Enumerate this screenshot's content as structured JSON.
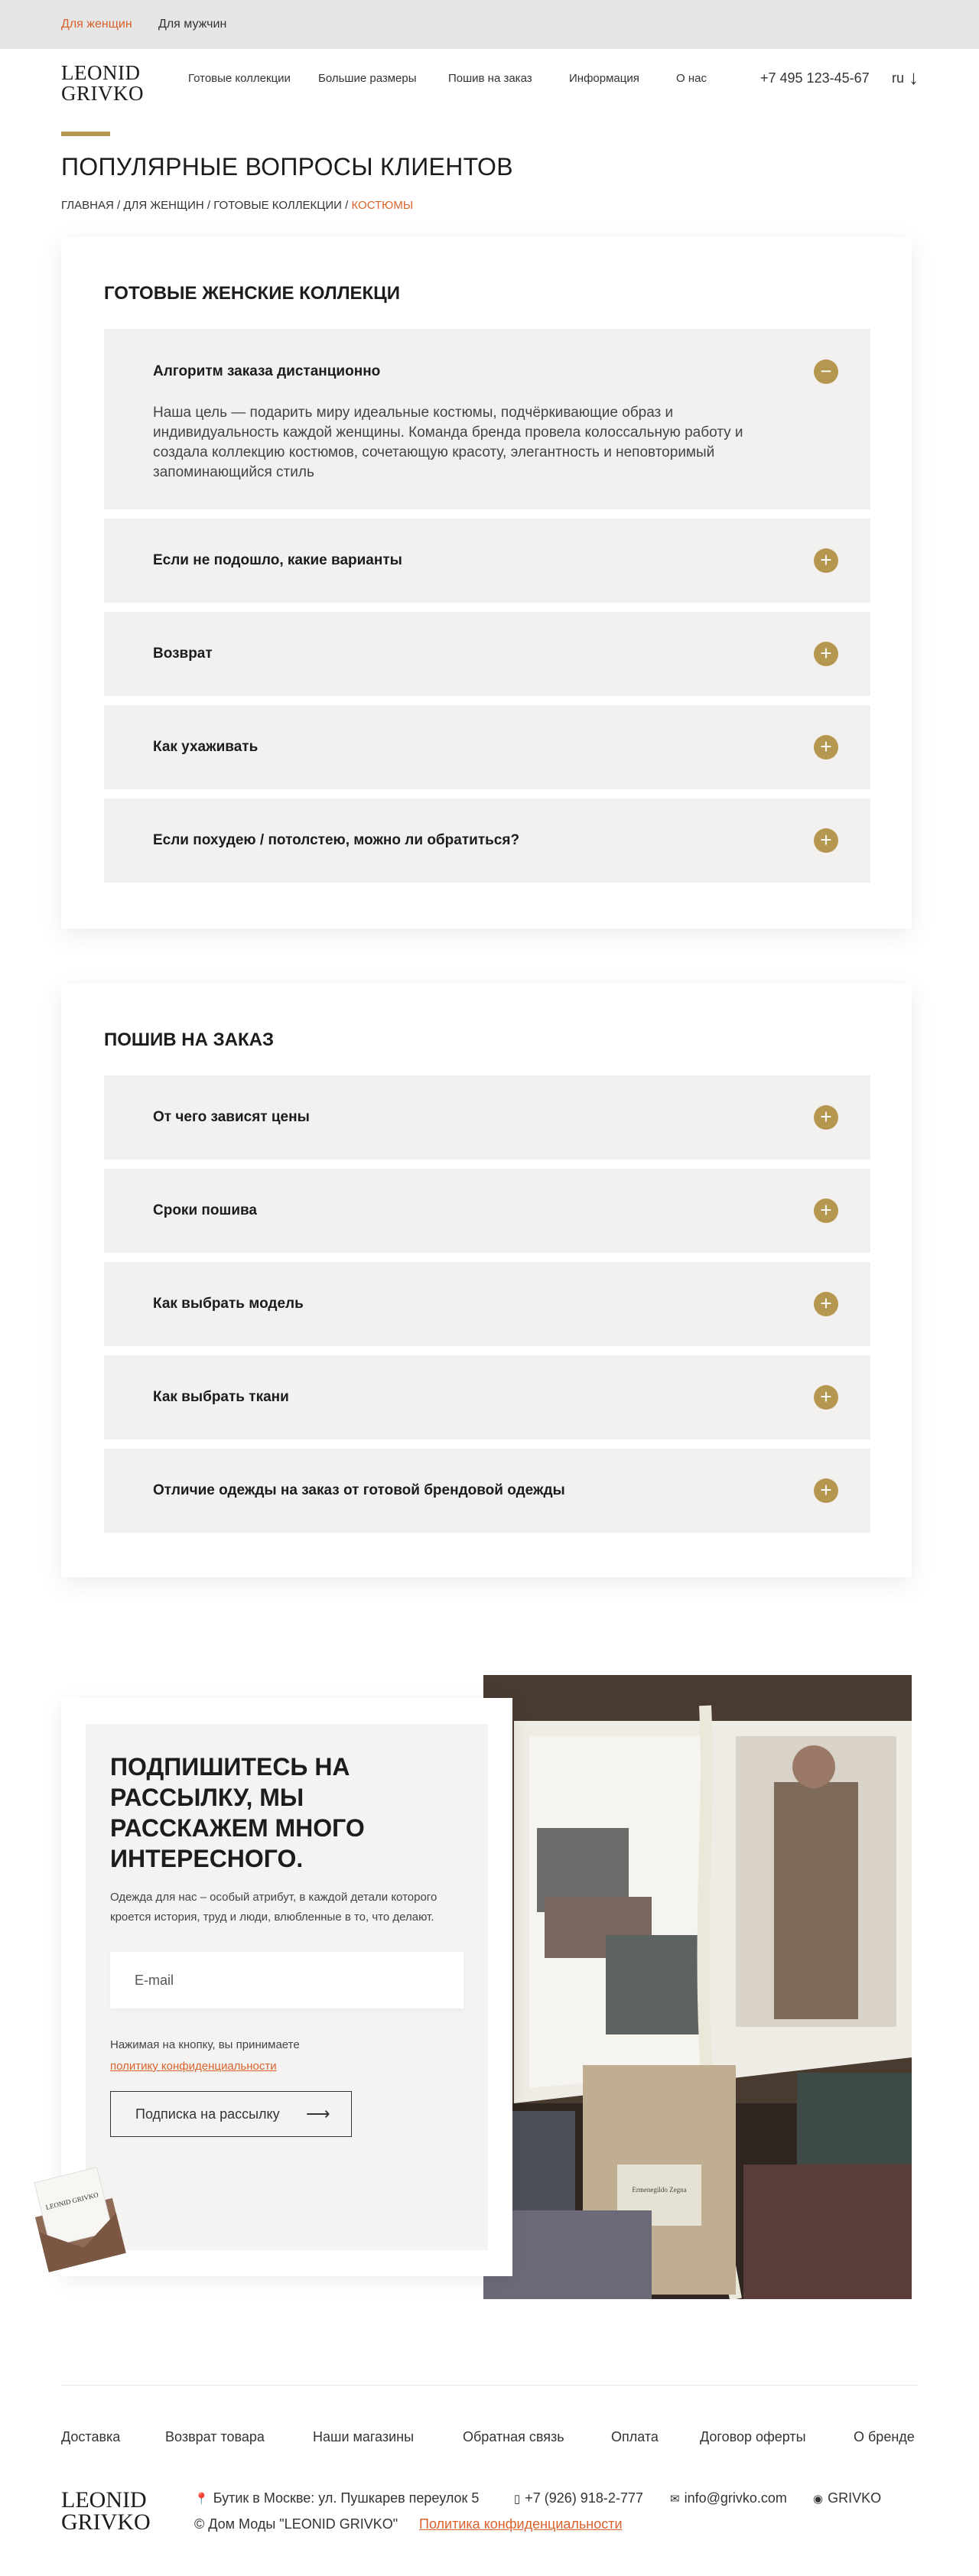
{
  "topbar": {
    "women": "Для женщин",
    "men": "Для мужчин"
  },
  "header": {
    "logo_line1": "LEONID",
    "logo_line2": "GRIVKO",
    "nav": [
      "Готовые коллекции",
      "Большие размеры",
      "Пошив на заказ",
      "Информация",
      "О нас"
    ],
    "phone": "+7 495 123-45-67",
    "lang": "ru",
    "lang_arrow": "↓"
  },
  "page": {
    "title": "ПОПУЛЯРНЫЕ ВОПРОСЫ КЛИЕНТОВ",
    "breadcrumb": [
      "ГЛАВНАЯ",
      "ДЛЯ ЖЕНЩИН",
      "ГОТОВЫЕ КОЛЛЕКЦИИ"
    ],
    "breadcrumb_sep": " / ",
    "breadcrumb_current": "КОСТЮМЫ"
  },
  "sections": [
    {
      "title": "ГОТОВЫЕ ЖЕНСКИЕ КОЛЛЕКЦИ",
      "items": [
        {
          "question": "Алгоритм заказа дистанционно",
          "answer": "Наша цель — подарить миру идеальные костюмы, подчёркивающие образ и индивидуальность каждой женщины. Команда бренда провела колоссальную работу и создала коллекцию костюмов, сочетающую красоту, элегантность и неповторимый запоминающийся стиль",
          "icon": "−"
        },
        {
          "question": "Если не подошло, какие варианты",
          "icon": "+"
        },
        {
          "question": "Возврат",
          "icon": "+"
        },
        {
          "question": "Как ухаживать",
          "icon": "+"
        },
        {
          "question": "Если похудею / потолстею, можно ли обратиться?",
          "icon": "+"
        }
      ]
    },
    {
      "title": "ПОШИВ НА ЗАКАЗ",
      "items": [
        {
          "question": "От чего зависят цены",
          "icon": "+"
        },
        {
          "question": "Сроки пошива",
          "icon": "+"
        },
        {
          "question": "Как выбрать модель",
          "icon": "+"
        },
        {
          "question": "Как выбрать ткани",
          "icon": "+"
        },
        {
          "question": "Отличие одежды на заказ от готовой брендовой одежды",
          "icon": "+"
        }
      ]
    }
  ],
  "subscribe": {
    "title": "ПОДПИШИТЕСЬ НА РАССЫЛКУ, МЫ РАССКАЖЕМ МНОГО ИНТЕРЕСНОГО.",
    "description": "Одежда для нас – особый атрибут, в каждой детали которого кроется история, труд и люди, влюбленные в то, что делают.",
    "email_placeholder": "E-mail",
    "consent_text": "Нажимая на кнопку, вы принимаете",
    "consent_link": "политику конфиденциальности",
    "button": "Подписка на рассылку",
    "button_arrow": "⟶",
    "envelope_logo": "LEONID GRIVKO",
    "photo_label": "Ermenegildo Zegna"
  },
  "footer": {
    "nav": [
      "Доставка",
      "Возврат товара",
      "Наши магазины",
      "Обратная связь",
      "Оплата",
      "Договор оферты",
      "О бренде"
    ],
    "logo_line1": "LEONID",
    "logo_line2": "GRIVKO",
    "address": "Бутик в Москве: ул. Пушкарев переулок 5",
    "phone": "+7 (926) 918-2-777",
    "email": "info@grivko.com",
    "social": "GRIVKO",
    "copyright": "© Дом Моды \"LEONID GRIVKO\"",
    "policy": "Политика конфиденциальности"
  },
  "colors": {
    "accent": "#b5974f",
    "link": "#d9622b",
    "accordion_bg": "#f2f1ef",
    "topbar_bg": "#e6e6e6"
  },
  "icons": {
    "address": "map-pin-icon",
    "phone": "phone-icon",
    "email": "mail-icon",
    "social": "instagram-icon"
  }
}
